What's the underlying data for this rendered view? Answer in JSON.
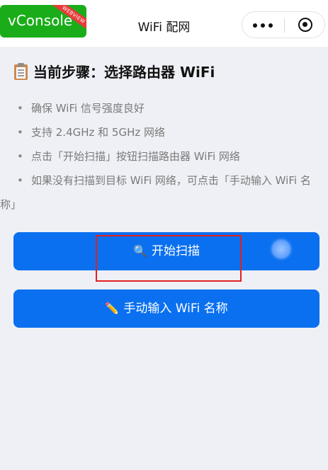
{
  "header": {
    "title": "WiFi 配网",
    "vconsole_label": "vConsole",
    "webview_badge": "WEBVIEW",
    "more_icon": "more-dots-icon",
    "close_icon": "target-circle-icon"
  },
  "step": {
    "icon": "clipboard-icon",
    "title": "当前步骤：选择路由器 WiFi"
  },
  "tips": {
    "bullet": "•",
    "items": [
      "确保 WiFi 信号强度良好",
      "支持 2.4GHz 和 5GHz 网络",
      "点击「开始扫描」按钮扫描路由器 WiFi 网络",
      "如果没有扫描到目标 WiFi 网络，可点击「手动输入 WiFi 名称」"
    ]
  },
  "buttons": {
    "scan": {
      "icon": "🔍",
      "label": "开始扫描"
    },
    "manual": {
      "icon": "✏️",
      "label": "手动输入 WiFi 名称"
    }
  },
  "colors": {
    "primary": "#0a70f0",
    "background": "#eff0f5",
    "vconsole_green": "#1aad19",
    "highlight_red": "#e02020"
  }
}
